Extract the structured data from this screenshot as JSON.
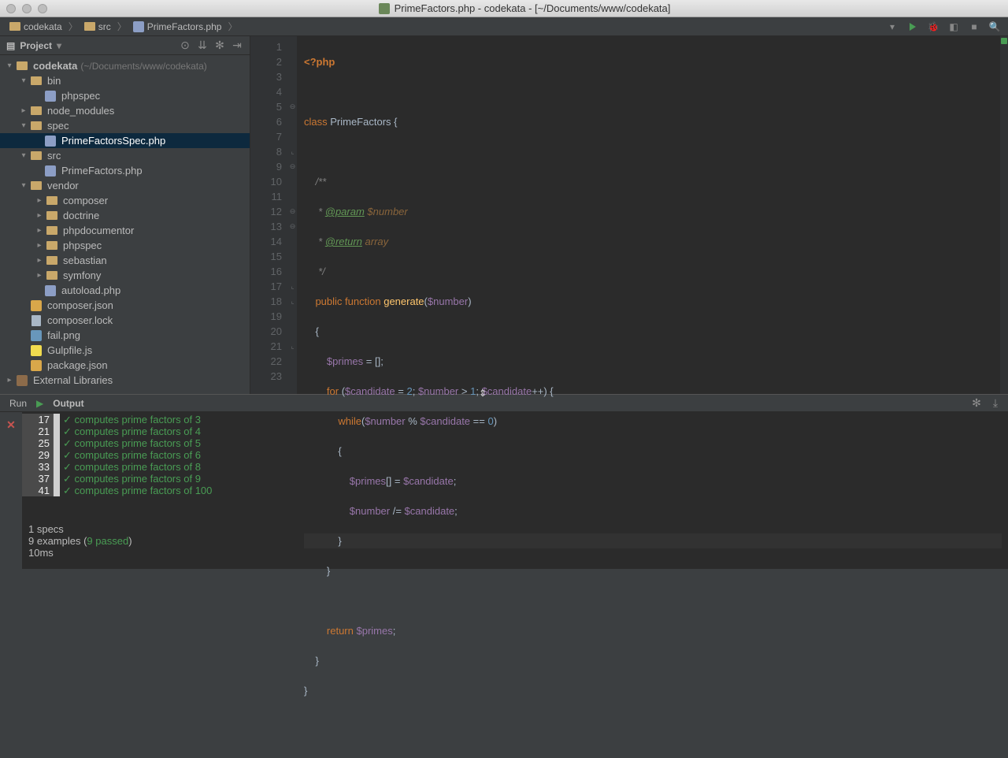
{
  "window": {
    "title": "PrimeFactors.php - codekata - [~/Documents/www/codekata]"
  },
  "breadcrumbs": {
    "root": "codekata",
    "folder": "src",
    "file": "PrimeFactors.php"
  },
  "project_header": {
    "label": "Project"
  },
  "tree": {
    "root": "codekata",
    "root_hint": "(~/Documents/www/codekata)",
    "bin": "bin",
    "bin_phpspec": "phpspec",
    "node_modules": "node_modules",
    "spec": "spec",
    "spec_file": "PrimeFactorsSpec.php",
    "src": "src",
    "src_file": "PrimeFactors.php",
    "vendor": "vendor",
    "v_composer": "composer",
    "v_doctrine": "doctrine",
    "v_phpdocumentor": "phpdocumentor",
    "v_phpspec": "phpspec",
    "v_sebastian": "sebastian",
    "v_symfony": "symfony",
    "v_autoload": "autoload.php",
    "composer_json": "composer.json",
    "composer_lock": "composer.lock",
    "fail_png": "fail.png",
    "gulpfile": "Gulpfile.js",
    "package_json": "package.json",
    "external": "External Libraries"
  },
  "editor": {
    "lines": [
      "1",
      "2",
      "3",
      "4",
      "5",
      "6",
      "7",
      "8",
      "9",
      "10",
      "11",
      "12",
      "13",
      "14",
      "15",
      "16",
      "17",
      "18",
      "19",
      "20",
      "21",
      "22",
      "23"
    ]
  },
  "bottom": {
    "run_label": "Run",
    "output_label": "Output"
  },
  "output": {
    "rows": [
      {
        "n": "17",
        "text": "computes prime factors of 3"
      },
      {
        "n": "21",
        "text": "computes prime factors of 4"
      },
      {
        "n": "25",
        "text": "computes prime factors of 5"
      },
      {
        "n": "29",
        "text": "computes prime factors of 6"
      },
      {
        "n": "33",
        "text": "computes prime factors of 8"
      },
      {
        "n": "37",
        "text": "computes prime factors of 9"
      },
      {
        "n": "41",
        "text": "computes prime factors of 100"
      }
    ],
    "summary1": "1 specs",
    "summary2a": "9 examples (",
    "summary2b": "9 passed",
    "summary2c": ")",
    "summary3": "10ms"
  }
}
